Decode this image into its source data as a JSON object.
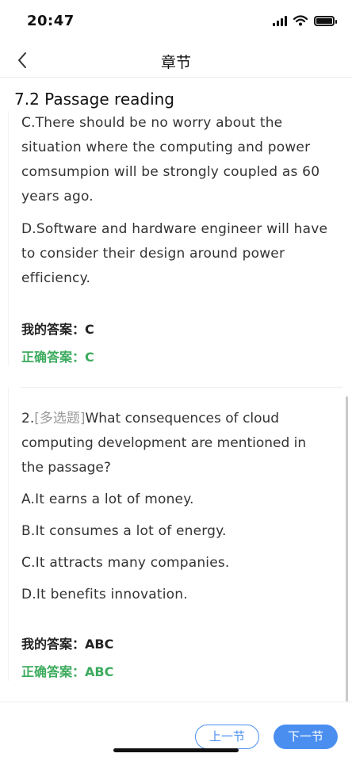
{
  "status_bar": {
    "time": "20:47"
  },
  "nav": {
    "title": "章节"
  },
  "section": {
    "title": "7.2 Passage reading"
  },
  "question1": {
    "options": [
      "C.There should be no worry about the situation where the computing and power comsumpion will be strongly coupled as 60 years ago.",
      "D.Software and hardware engineer will have to consider their design around power efficiency."
    ],
    "my_answer_label": "我的答案：",
    "my_answer": "C",
    "correct_answer_label": "正确答案：",
    "correct_answer": "C"
  },
  "question2": {
    "number": "2.",
    "type": "[多选题]",
    "stem": "What consequences of cloud computing development are mentioned in the passage?",
    "options": [
      "A.It earns a lot of money.",
      "B.It consumes a lot of energy.",
      "C.It attracts many companies.",
      "D.It benefits innovation."
    ],
    "my_answer_label": "我的答案：",
    "my_answer": "ABC",
    "correct_answer_label": "正确答案：",
    "correct_answer": "ABC"
  },
  "buttons": {
    "prev": "上一节",
    "next": "下一节"
  },
  "icons": {
    "back": "chevron-left-icon",
    "signal": "cellular-signal-icon",
    "wifi": "wifi-icon",
    "battery": "battery-icon"
  },
  "colors": {
    "accent": "#4a8ff0",
    "correct": "#3cab5e"
  }
}
